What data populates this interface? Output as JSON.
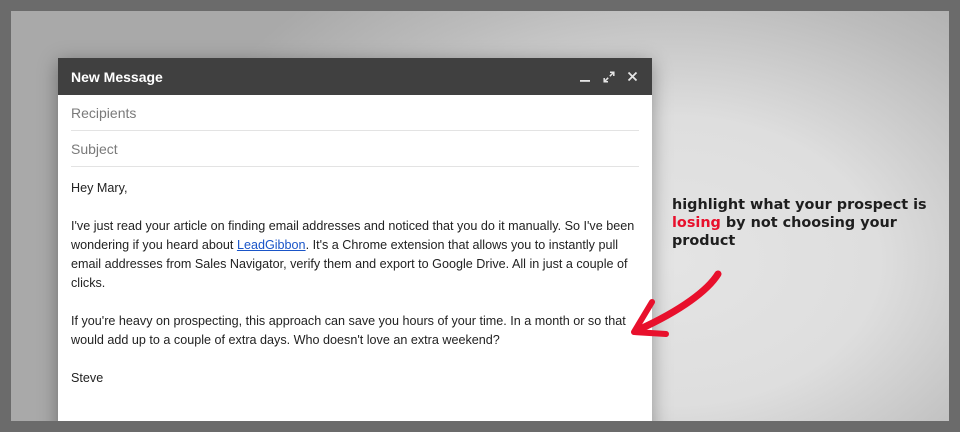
{
  "compose": {
    "title": "New Message",
    "recipients_placeholder": "Recipients",
    "subject_placeholder": "Subject",
    "icons": [
      "minimize-icon",
      "expand-icon",
      "close-icon"
    ]
  },
  "email": {
    "greeting": "Hey Mary,",
    "p1_before": "I've just read your article on finding email addresses and noticed that you do it manually. So I've been wondering if you heard about ",
    "p1_link": "LeadGibbon",
    "p1_after": ". It's a Chrome extension that allows you to instantly pull email addresses from Sales Navigator, verify them and export to Google Drive. All in just a couple of clicks.",
    "p2": "If you're heavy on prospecting, this approach can save you hours of your time. In a month or so that would add up to a couple of extra days. Who doesn't love an extra weekend?",
    "signature": "Steve"
  },
  "annotation": {
    "before": "highlight what your prospect is ",
    "highlight": "losing",
    "after": " by not choosing your product",
    "highlight_color": "#e8102c"
  }
}
